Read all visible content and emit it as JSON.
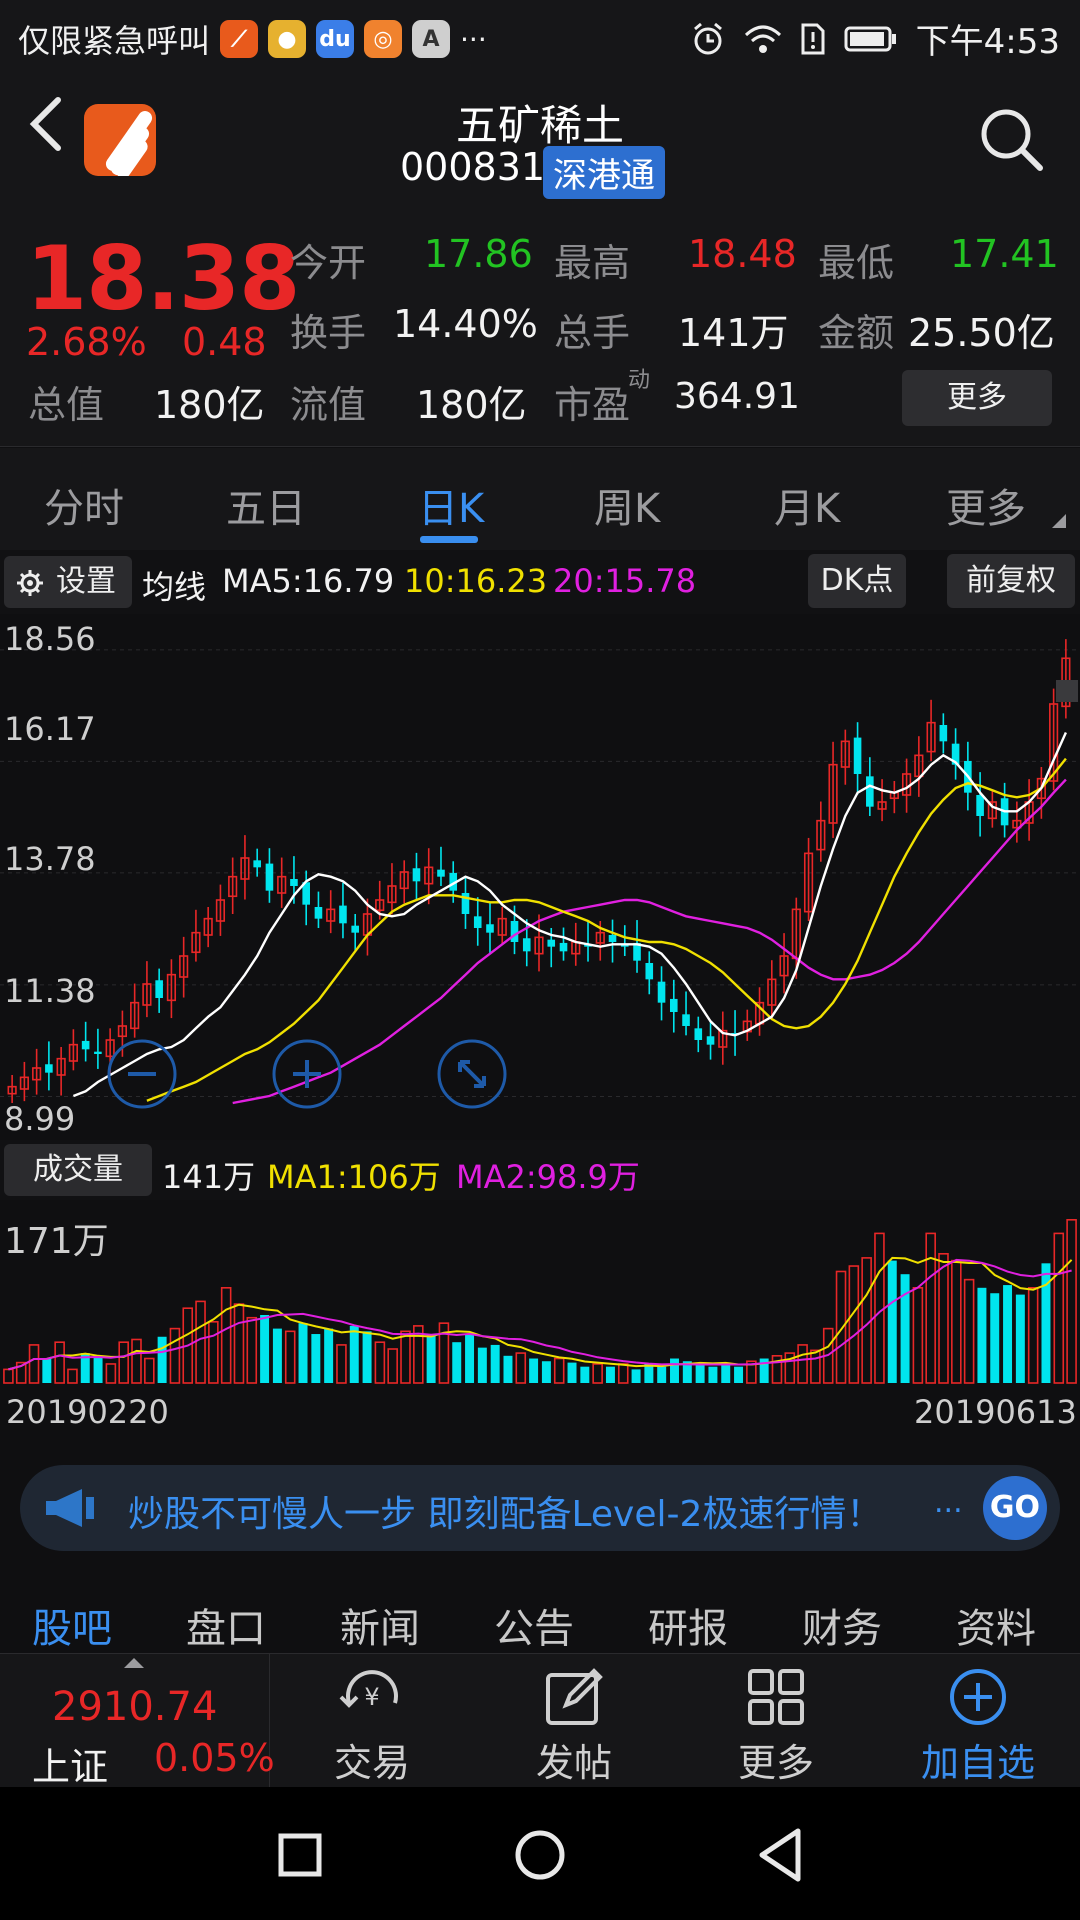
{
  "status_bar": {
    "left_text": "仅限紧急呼叫",
    "app_icons": [
      "eastmoney-icon",
      "coin-icon",
      "baidu-icon",
      "squirrel-icon",
      "a-icon"
    ],
    "more": "···",
    "time": "下午4:53"
  },
  "header": {
    "title": "五矿稀土",
    "code": "000831",
    "tag": "深港通"
  },
  "quote": {
    "price": "18.38",
    "change_pct": "2.68%",
    "change": "0.48",
    "market_cap_label": "总值",
    "market_cap": "180亿",
    "open_label": "今开",
    "open": "17.86",
    "high_label": "最高",
    "high": "18.48",
    "low_label": "最低",
    "low": "17.41",
    "turnover_label": "换手",
    "turnover": "14.40%",
    "volume_label": "总手",
    "volume": "141万",
    "amount_label": "金额",
    "amount": "25.50亿",
    "float_label": "流值",
    "float": "180亿",
    "pe_label": "市盈",
    "pe_sup": "动",
    "pe": "364.91",
    "more": "更多"
  },
  "tabs": [
    "分时",
    "五日",
    "日K",
    "周K",
    "月K",
    "更多"
  ],
  "active_tab": "日K",
  "ma_bar": {
    "settings": "设置",
    "label": "均线",
    "ma5": "MA5:16.79",
    "ma10": "10:16.23",
    "ma20": "20:15.78",
    "dk": "DK点",
    "adjust": "前复权"
  },
  "colors": {
    "up": "#e82727",
    "down": "#00e5ee",
    "ma5": "#ffffff",
    "ma10": "#f0e000",
    "ma20": "#e020e0",
    "accent": "#3a8ff0"
  },
  "chart_data": {
    "type": "candlestick",
    "y_ticks": [
      "18.56",
      "16.17",
      "13.78",
      "11.38",
      "8.99"
    ],
    "ylim": [
      8.99,
      18.56
    ],
    "closes": [
      9.2,
      9.4,
      9.6,
      9.5,
      9.8,
      10.1,
      10.0,
      9.9,
      10.2,
      10.5,
      11.0,
      11.4,
      11.1,
      11.6,
      12.0,
      12.5,
      12.8,
      13.2,
      13.7,
      14.1,
      13.9,
      13.4,
      13.7,
      13.5,
      13.1,
      12.8,
      13.0,
      12.7,
      12.5,
      12.9,
      13.2,
      13.5,
      13.8,
      13.6,
      13.9,
      13.7,
      13.4,
      12.9,
      12.6,
      12.5,
      12.8,
      12.3,
      12.1,
      12.4,
      12.2,
      12.1,
      12.3,
      12.2,
      12.5,
      12.3,
      12.2,
      11.9,
      11.5,
      11.0,
      10.8,
      10.5,
      10.2,
      10.1,
      10.4,
      10.3,
      10.6,
      11.0,
      11.5,
      12.0,
      13.0,
      14.2,
      14.9,
      16.1,
      16.6,
      15.9,
      15.2,
      15.3,
      15.5,
      15.9,
      16.3,
      17.0,
      16.6,
      16.1,
      15.5,
      15.0,
      15.3,
      14.8,
      14.9,
      15.3,
      15.8,
      17.4,
      18.38
    ],
    "ma5": [
      9.0,
      9.1,
      9.3,
      9.45,
      9.6,
      9.75,
      9.9,
      10.0,
      10.05,
      10.2,
      10.45,
      10.7,
      10.9,
      11.25,
      11.6,
      12.0,
      12.5,
      12.9,
      13.3,
      13.6,
      13.75,
      13.7,
      13.6,
      13.4,
      13.1,
      12.9,
      12.85,
      12.9,
      13.1,
      13.25,
      13.4,
      13.55,
      13.7,
      13.6,
      13.4,
      13.1,
      12.9,
      12.7,
      12.55,
      12.45,
      12.4,
      12.3,
      12.25,
      12.2,
      12.25,
      12.25,
      12.25,
      12.2,
      12.05,
      11.75,
      11.4,
      11.0,
      10.6,
      10.35,
      10.3,
      10.4,
      10.55,
      10.7,
      11.1,
      11.7,
      12.6,
      13.5,
      14.3,
      15.0,
      15.5,
      15.65,
      15.55,
      15.5,
      15.6,
      15.8,
      16.1,
      16.3,
      16.15,
      15.85,
      15.5,
      15.2,
      15.1,
      15.1,
      15.3,
      15.6,
      16.2,
      16.79
    ],
    "ma10": [
      8.9,
      9.0,
      9.1,
      9.2,
      9.3,
      9.45,
      9.6,
      9.75,
      9.9,
      10.0,
      10.15,
      10.35,
      10.55,
      10.8,
      11.05,
      11.4,
      11.75,
      12.1,
      12.45,
      12.7,
      12.95,
      13.1,
      13.2,
      13.3,
      13.3,
      13.3,
      13.25,
      13.2,
      13.15,
      13.15,
      13.2,
      13.2,
      13.15,
      13.05,
      12.95,
      12.85,
      12.75,
      12.6,
      12.5,
      12.4,
      12.35,
      12.3,
      12.3,
      12.25,
      12.15,
      12.0,
      11.85,
      11.65,
      11.4,
      11.15,
      10.9,
      10.65,
      10.5,
      10.45,
      10.5,
      10.7,
      11.0,
      11.4,
      11.9,
      12.5,
      13.1,
      13.7,
      14.2,
      14.65,
      15.05,
      15.35,
      15.6,
      15.7,
      15.65,
      15.55,
      15.45,
      15.4,
      15.45,
      15.6,
      15.9,
      16.23
    ],
    "ma20": [
      8.85,
      8.9,
      8.95,
      9.0,
      9.1,
      9.2,
      9.3,
      9.4,
      9.5,
      9.65,
      9.8,
      9.95,
      10.1,
      10.3,
      10.5,
      10.7,
      10.9,
      11.1,
      11.35,
      11.6,
      11.85,
      12.05,
      12.25,
      12.45,
      12.6,
      12.75,
      12.85,
      12.95,
      13.0,
      13.05,
      13.1,
      13.15,
      13.2,
      13.2,
      13.15,
      13.05,
      12.95,
      12.85,
      12.8,
      12.75,
      12.7,
      12.65,
      12.6,
      12.5,
      12.35,
      12.15,
      11.95,
      11.75,
      11.6,
      11.5,
      11.5,
      11.55,
      11.6,
      11.7,
      11.85,
      12.05,
      12.3,
      12.6,
      12.9,
      13.2,
      13.5,
      13.8,
      14.1,
      14.4,
      14.7,
      14.95,
      15.2,
      15.5,
      15.78
    ]
  },
  "volume": {
    "label": "成交量",
    "value": "141万",
    "ma1": "MA1:106万",
    "ma2": "MA2:98.9万",
    "max_label": "171万"
  },
  "volume_data": [
    10,
    15,
    28,
    18,
    30,
    10,
    22,
    20,
    14,
    30,
    32,
    18,
    34,
    40,
    55,
    60,
    45,
    70,
    58,
    48,
    50,
    40,
    38,
    44,
    36,
    40,
    28,
    42,
    38,
    30,
    25,
    38,
    42,
    36,
    44,
    30,
    36,
    26,
    28,
    20,
    22,
    18,
    16,
    18,
    15,
    12,
    14,
    12,
    14,
    10,
    14,
    12,
    18,
    16,
    14,
    12,
    14,
    12,
    16,
    18,
    20,
    22,
    28,
    24,
    40,
    82,
    86,
    92,
    110,
    90,
    80,
    70,
    110,
    95,
    90,
    76,
    70,
    66,
    72,
    65,
    70,
    88,
    110,
    120
  ],
  "date_start": "20190220",
  "date_end": "20190613",
  "banner": {
    "text": "炒股不可慢人一步 即刻配备Level-2极速行情！",
    "ellipsis": "...",
    "go": "GO"
  },
  "bottom_tabs": [
    "股吧",
    "盘口",
    "新闻",
    "公告",
    "研报",
    "财务",
    "资料"
  ],
  "footer": {
    "index_value": "2910.74",
    "index_name": "上证",
    "index_change": "0.05%",
    "trade": "交易",
    "post": "发帖",
    "more": "更多",
    "add_watch": "加自选"
  }
}
